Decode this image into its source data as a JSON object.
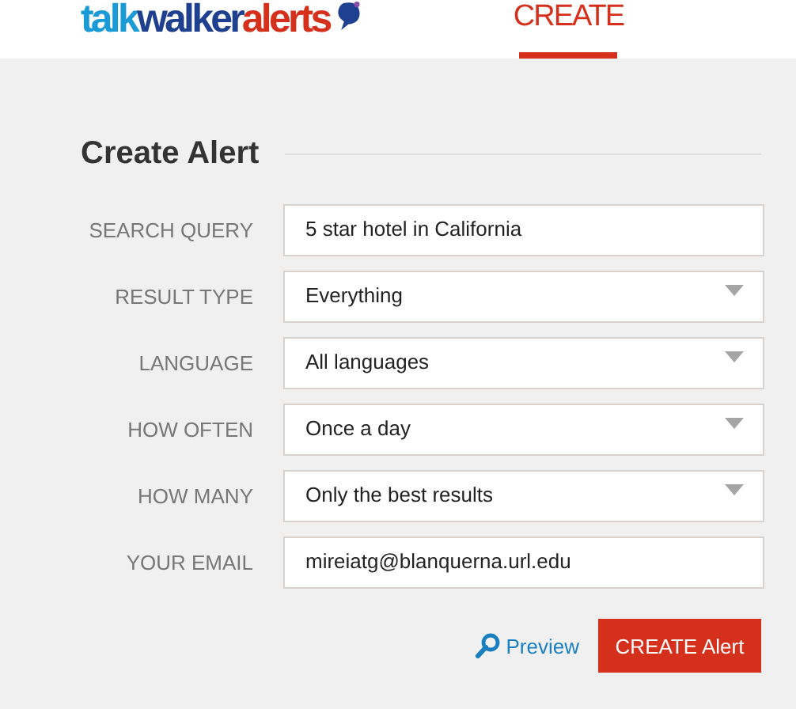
{
  "logo": {
    "parts": [
      {
        "text": "talk",
        "color": "#1a9ad6"
      },
      {
        "text": "walker",
        "color": "#1f3f8f"
      },
      {
        "text": "alerts",
        "color": "#d4301c"
      }
    ]
  },
  "tabs": [
    {
      "label": "CREATE",
      "selected": true
    }
  ],
  "form": {
    "title": "Create Alert",
    "fields": [
      {
        "label": "SEARCH QUERY",
        "kind": "text",
        "value": "5 star hotel in California"
      },
      {
        "label": "RESULT TYPE",
        "kind": "select",
        "value": "Everything"
      },
      {
        "label": "LANGUAGE",
        "kind": "select",
        "value": "All languages"
      },
      {
        "label": "HOW OFTEN",
        "kind": "select",
        "value": "Once a day"
      },
      {
        "label": "HOW MANY",
        "kind": "select",
        "value": "Only the best results"
      },
      {
        "label": "YOUR EMAIL",
        "kind": "text",
        "value": "mireiatg@blanquerna.url.edu"
      }
    ]
  },
  "actions": {
    "preview": "Preview",
    "create": "CREATE Alert"
  }
}
